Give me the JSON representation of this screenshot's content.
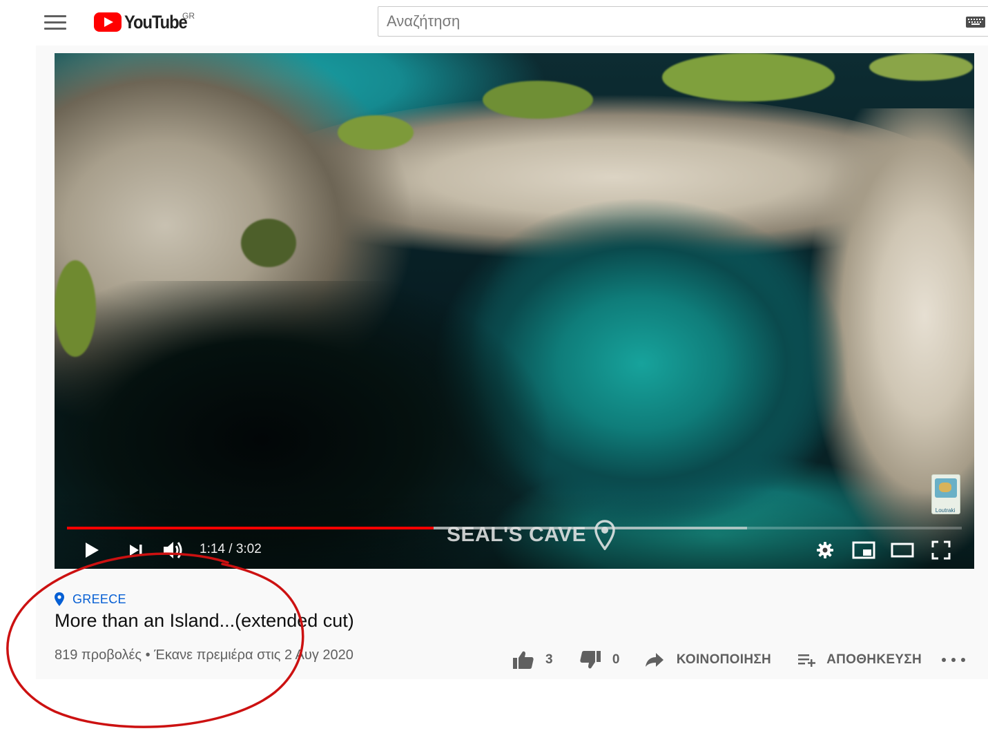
{
  "masthead": {
    "logo_text": "YouTube",
    "country_code": "GR",
    "search": {
      "placeholder": "Αναζήτηση",
      "value": ""
    }
  },
  "player": {
    "location_overlay": "SEAL'S CAVE",
    "watermark_label": "Loutraki",
    "time_current": "1:14",
    "time_total": "3:02",
    "time_display": "1:14 / 3:02",
    "progress_fraction": 0.41,
    "buffered_fraction": 0.76
  },
  "video": {
    "location_tag": "GREECE",
    "title": "More than an Island...(extended cut)",
    "meta": "819 προβολές • Έκανε πρεμιέρα στις 2 Αυγ 2020"
  },
  "actions": {
    "likes": "3",
    "dislikes": "0",
    "share_label": "ΚΟΙΝΟΠΟΙΗΣΗ",
    "save_label": "ΑΠΟΘΗΚΕΥΣΗ"
  },
  "colors": {
    "accent_red": "#ff0000",
    "link_blue": "#065fd4",
    "annotation_red": "#cc1111"
  }
}
